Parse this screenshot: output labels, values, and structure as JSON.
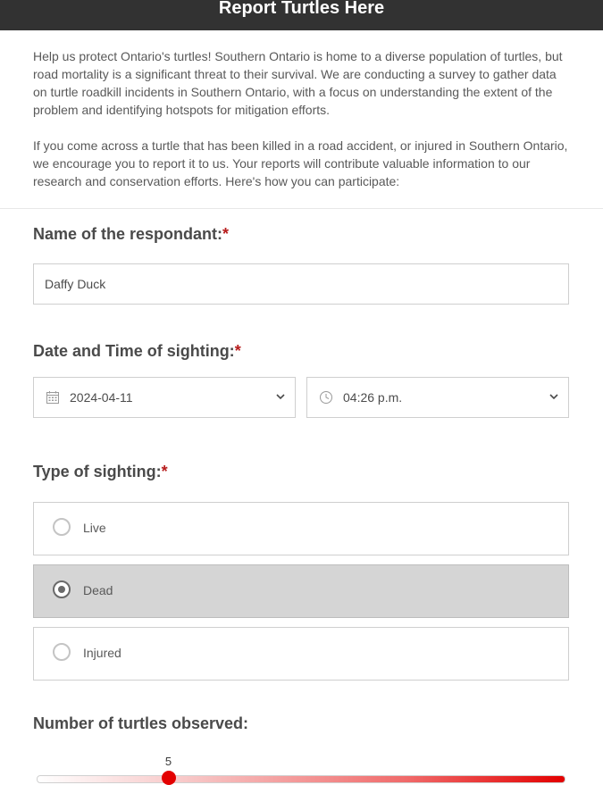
{
  "header": {
    "title": "Report Turtles Here"
  },
  "intro": {
    "paragraph1": "Help us protect Ontario's turtles! Southern Ontario is home to a diverse population of turtles, but road mortality is a significant threat to their survival. We are conducting a survey to gather data on turtle roadkill incidents in Southern Ontario, with a focus on understanding the extent of the problem and identifying hotspots for mitigation efforts.",
    "paragraph2": "If you come across a turtle that has been killed in a road accident, or injured in Southern Ontario, we encourage you to report it to us. Your reports will contribute valuable information to our research and conservation efforts. Here's how you can participate:"
  },
  "respondent": {
    "label": "Name of the respondant:",
    "required_mark": "*",
    "value": "Daffy Duck"
  },
  "datetime": {
    "label": "Date and Time of sighting:",
    "required_mark": "*",
    "date_value": "2024-04-11",
    "time_value": "04:26 p.m.",
    "date_icon": "calendar-icon",
    "time_icon": "clock-icon"
  },
  "sighting": {
    "label": "Type of sighting:",
    "required_mark": "*",
    "options": [
      {
        "label": "Live",
        "selected": false
      },
      {
        "label": "Dead",
        "selected": true
      },
      {
        "label": "Injured",
        "selected": false
      }
    ]
  },
  "turtles": {
    "label": "Number of turtles observed:",
    "value": "5",
    "min": 0,
    "max": 20
  },
  "colors": {
    "header_bg": "#323232",
    "required": "#b71c1c",
    "selected_bg": "#d5d5d5",
    "slider_accent": "#e30000"
  }
}
